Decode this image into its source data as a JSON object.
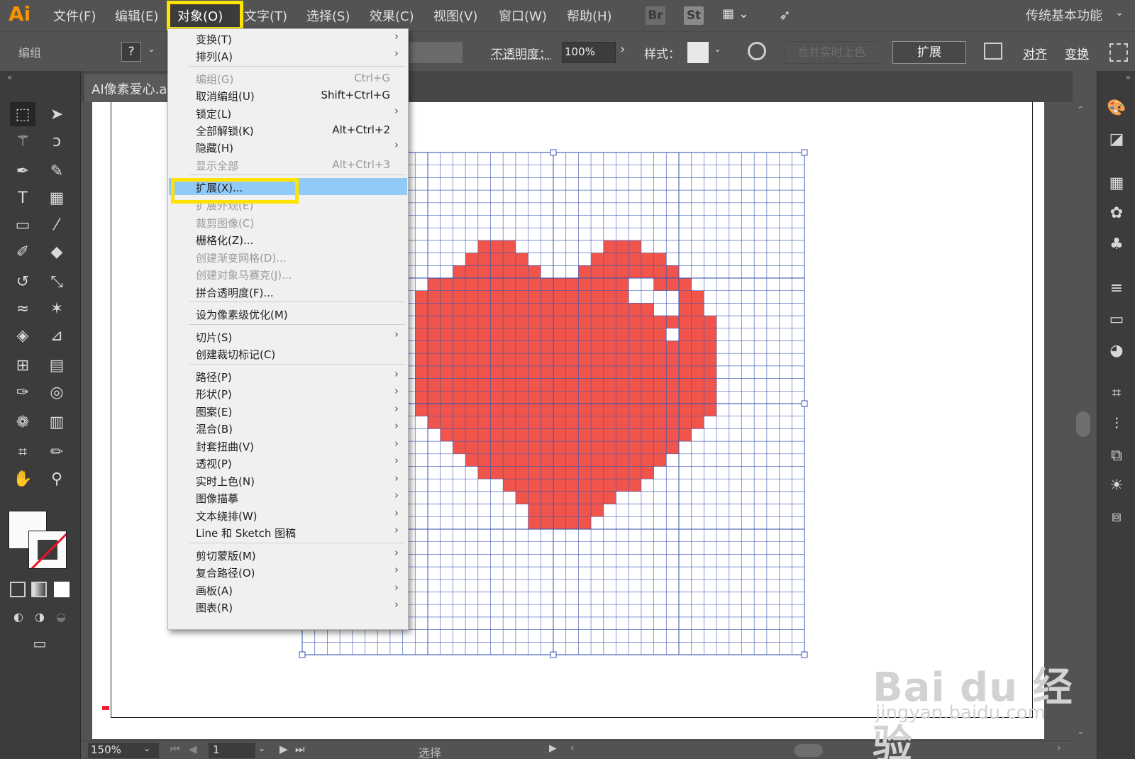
{
  "app": {
    "logo": "Ai"
  },
  "menubar": {
    "items": [
      "文件(F)",
      "编辑(E)",
      "对象(O)",
      "文字(T)",
      "选择(S)",
      "效果(C)",
      "视图(V)",
      "窗口(W)",
      "帮助(H)"
    ],
    "badges": [
      "Br",
      "St"
    ],
    "workspace": "传统基本功能"
  },
  "controlbar": {
    "group_label": "编组",
    "help_box": "?",
    "opacity_label": "不透明度：",
    "opacity_value": "100%",
    "style_label": "样式：",
    "merge_button": "合并实时上色",
    "expand_button": "扩展",
    "align_link": "对齐",
    "transform_link": "变换"
  },
  "document": {
    "tab_title": "AI像素爱心.ai"
  },
  "object_menu": {
    "items": [
      {
        "label": "变换(T)",
        "shortcut": "",
        "submenu": true,
        "disabled": false
      },
      {
        "label": "排列(A)",
        "shortcut": "",
        "submenu": true,
        "disabled": false
      },
      {
        "label": "编组(G)",
        "shortcut": "Ctrl+G",
        "submenu": false,
        "disabled": true
      },
      {
        "label": "取消编组(U)",
        "shortcut": "Shift+Ctrl+G",
        "submenu": false,
        "disabled": false
      },
      {
        "label": "锁定(L)",
        "shortcut": "",
        "submenu": true,
        "disabled": false
      },
      {
        "label": "全部解锁(K)",
        "shortcut": "Alt+Ctrl+2",
        "submenu": false,
        "disabled": false
      },
      {
        "label": "隐藏(H)",
        "shortcut": "",
        "submenu": true,
        "disabled": false
      },
      {
        "label": "显示全部",
        "shortcut": "Alt+Ctrl+3",
        "submenu": false,
        "disabled": true
      },
      {
        "label": "扩展(X)...",
        "shortcut": "",
        "submenu": false,
        "disabled": false,
        "highlight": true
      },
      {
        "label": "扩展外观(E)",
        "shortcut": "",
        "submenu": false,
        "disabled": true
      },
      {
        "label": "裁剪图像(C)",
        "shortcut": "",
        "submenu": false,
        "disabled": true
      },
      {
        "label": "栅格化(Z)...",
        "shortcut": "",
        "submenu": false,
        "disabled": false
      },
      {
        "label": "创建渐变网格(D)...",
        "shortcut": "",
        "submenu": false,
        "disabled": true
      },
      {
        "label": "创建对象马赛克(J)...",
        "shortcut": "",
        "submenu": false,
        "disabled": true
      },
      {
        "label": "拼合透明度(F)...",
        "shortcut": "",
        "submenu": false,
        "disabled": false
      },
      {
        "label": "设为像素级优化(M)",
        "shortcut": "",
        "submenu": false,
        "disabled": false
      },
      {
        "label": "切片(S)",
        "shortcut": "",
        "submenu": true,
        "disabled": false
      },
      {
        "label": "创建裁切标记(C)",
        "shortcut": "",
        "submenu": false,
        "disabled": false
      },
      {
        "label": "路径(P)",
        "shortcut": "",
        "submenu": true,
        "disabled": false
      },
      {
        "label": "形状(P)",
        "shortcut": "",
        "submenu": true,
        "disabled": false
      },
      {
        "label": "图案(E)",
        "shortcut": "",
        "submenu": true,
        "disabled": false
      },
      {
        "label": "混合(B)",
        "shortcut": "",
        "submenu": true,
        "disabled": false
      },
      {
        "label": "封套扭曲(V)",
        "shortcut": "",
        "submenu": true,
        "disabled": false
      },
      {
        "label": "透视(P)",
        "shortcut": "",
        "submenu": true,
        "disabled": false
      },
      {
        "label": "实时上色(N)",
        "shortcut": "",
        "submenu": true,
        "disabled": false
      },
      {
        "label": "图像描摹",
        "shortcut": "",
        "submenu": true,
        "disabled": false
      },
      {
        "label": "文本绕排(W)",
        "shortcut": "",
        "submenu": true,
        "disabled": false
      },
      {
        "label": "Line 和 Sketch 图稿",
        "shortcut": "",
        "submenu": true,
        "disabled": false
      },
      {
        "label": "剪切蒙版(M)",
        "shortcut": "",
        "submenu": true,
        "disabled": false
      },
      {
        "label": "复合路径(O)",
        "shortcut": "",
        "submenu": true,
        "disabled": false
      },
      {
        "label": "画板(A)",
        "shortcut": "",
        "submenu": true,
        "disabled": false
      },
      {
        "label": "图表(R)",
        "shortcut": "",
        "submenu": true,
        "disabled": false
      }
    ]
  },
  "statusbar": {
    "zoom": "150%",
    "page": "1",
    "current_tool": "选择"
  },
  "artwork": {
    "heart_color": "#f0544a",
    "grid_color": "#3a55b0",
    "highlight_color": "#ffe300",
    "heart_rows": [
      "...........................................",
      "...........................................",
      "...........................................",
      "...........................................",
      "...........................................",
      "...........................................",
      "...........................................",
      ".............................................",
      "................................................",
      "..........................................................",
      ".........................................................",
      "........................................................................."
    ]
  },
  "watermark": {
    "brand": "Bai du 经验",
    "url": "jingyan.baidu.com"
  }
}
